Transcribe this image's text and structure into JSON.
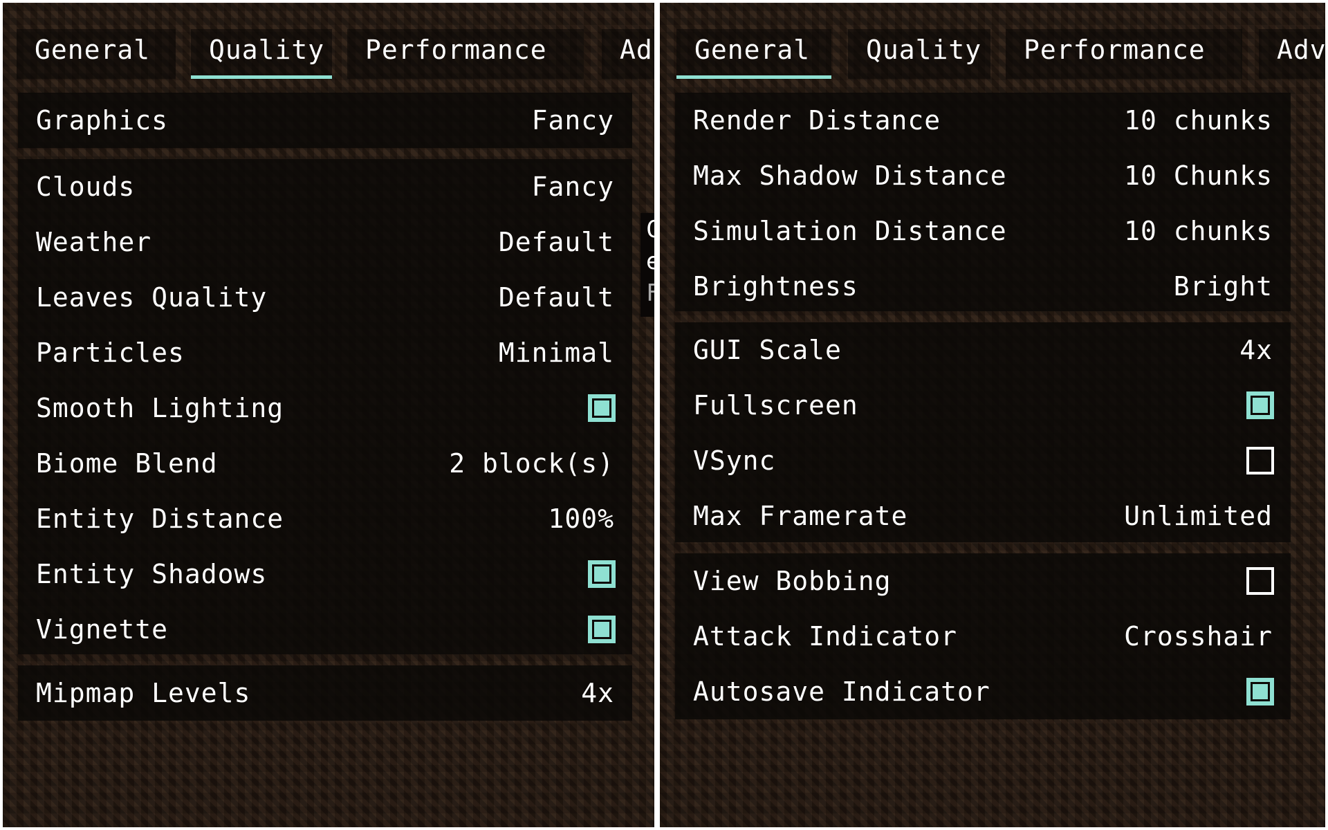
{
  "accent_color": "#8fe0d2",
  "left_panel": {
    "tabs": [
      {
        "label": "General",
        "active": false
      },
      {
        "label": "Quality",
        "active": true
      },
      {
        "label": "Performance",
        "active": false
      },
      {
        "label": "Ad",
        "active": false
      }
    ],
    "groups": [
      {
        "rows": [
          {
            "label": "Graphics",
            "value": "Fancy",
            "type": "value"
          }
        ]
      },
      {
        "rows": [
          {
            "label": "Clouds",
            "value": "Fancy",
            "type": "value"
          },
          {
            "label": "Weather",
            "value": "Default",
            "type": "value"
          },
          {
            "label": "Leaves Quality",
            "value": "Default",
            "type": "value"
          },
          {
            "label": "Particles",
            "value": "Minimal",
            "type": "value"
          },
          {
            "label": "Smooth Lighting",
            "checked": true,
            "type": "checkbox"
          },
          {
            "label": "Biome Blend",
            "value": "2 block(s)",
            "type": "value"
          },
          {
            "label": "Entity Distance",
            "value": "100%",
            "type": "value"
          },
          {
            "label": "Entity Shadows",
            "checked": true,
            "type": "checkbox"
          },
          {
            "label": "Vignette",
            "checked": true,
            "type": "checkbox"
          }
        ]
      },
      {
        "rows": [
          {
            "label": "Mipmap Levels",
            "value": "4x",
            "type": "value"
          }
        ]
      }
    ],
    "tooltip_fragment": [
      "C",
      "e",
      "F"
    ]
  },
  "right_panel": {
    "tabs": [
      {
        "label": "General",
        "active": true
      },
      {
        "label": "Quality",
        "active": false
      },
      {
        "label": "Performance",
        "active": false
      },
      {
        "label": "Adv",
        "active": false
      }
    ],
    "groups": [
      {
        "rows": [
          {
            "label": "Render Distance",
            "value": "10 chunks",
            "type": "value"
          },
          {
            "label": "Max Shadow Distance",
            "value": "10 Chunks",
            "type": "value"
          },
          {
            "label": "Simulation Distance",
            "value": "10 chunks",
            "type": "value"
          },
          {
            "label": "Brightness",
            "value": "Bright",
            "type": "value"
          }
        ]
      },
      {
        "rows": [
          {
            "label": "GUI Scale",
            "value": "4x",
            "type": "value"
          },
          {
            "label": "Fullscreen",
            "checked": true,
            "type": "checkbox"
          },
          {
            "label": "VSync",
            "checked": false,
            "type": "checkbox"
          },
          {
            "label": "Max Framerate",
            "value": "Unlimited",
            "type": "value"
          }
        ]
      },
      {
        "rows": [
          {
            "label": "View Bobbing",
            "checked": false,
            "type": "checkbox"
          },
          {
            "label": "Attack Indicator",
            "value": "Crosshair",
            "type": "value"
          },
          {
            "label": "Autosave Indicator",
            "checked": true,
            "type": "checkbox"
          }
        ]
      }
    ]
  }
}
